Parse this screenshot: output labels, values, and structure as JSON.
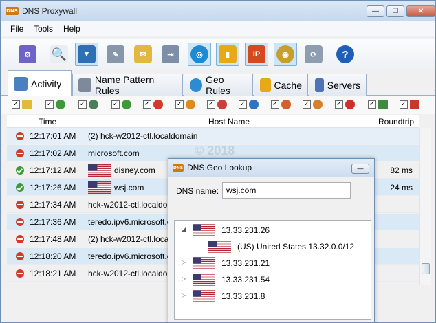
{
  "app": {
    "title": "DNS Proxywall",
    "icon_text": "DNS"
  },
  "menu": [
    "File",
    "Tools",
    "Help"
  ],
  "window_buttons": {
    "minimize": "—",
    "maximize": "☐",
    "close": "✕"
  },
  "toolbar": [
    "settings-icon",
    "search-icon",
    "filter-icon",
    "edit-icon",
    "mail-transfer-icon",
    "network-export-icon",
    "globe-icon",
    "stats-icon",
    "ip-block-icon",
    "coins-globe-icon",
    "sync-icon",
    "help-icon"
  ],
  "tabs": [
    {
      "label": "Activity",
      "active": true
    },
    {
      "label": "Name Pattern Rules",
      "active": false
    },
    {
      "label": "Geo Rules",
      "active": false
    },
    {
      "label": "Cache",
      "active": false
    },
    {
      "label": "Servers",
      "active": false
    }
  ],
  "grid": {
    "headers": {
      "time": "Time",
      "host": "Host Name",
      "roundtrip": "Roundtrip"
    },
    "rows": [
      {
        "status": "blocked",
        "time": "12:17:01 AM",
        "host": "(2) hck-w2012-ctl.localdomain",
        "flag": false,
        "roundtrip": ""
      },
      {
        "status": "blocked",
        "time": "12:17:02 AM",
        "host": "microsoft.com",
        "flag": false,
        "roundtrip": ""
      },
      {
        "status": "ok",
        "time": "12:17:12 AM",
        "host": "disney.com",
        "flag": true,
        "roundtrip": "82 ms"
      },
      {
        "status": "ok",
        "time": "12:17:26 AM",
        "host": "wsj.com",
        "flag": true,
        "roundtrip": "24 ms"
      },
      {
        "status": "blocked",
        "time": "12:17:34 AM",
        "host": "hck-w2012-ctl.localdo",
        "flag": false,
        "roundtrip": ""
      },
      {
        "status": "blocked",
        "time": "12:17:36 AM",
        "host": "teredo.ipv6.microsoft.c",
        "flag": false,
        "roundtrip": ""
      },
      {
        "status": "blocked",
        "time": "12:17:48 AM",
        "host": "(2) hck-w2012-ctl.localdo",
        "flag": false,
        "roundtrip": ""
      },
      {
        "status": "blocked",
        "time": "12:18:20 AM",
        "host": "teredo.ipv6.microsoft.c",
        "flag": false,
        "roundtrip": ""
      },
      {
        "status": "blocked",
        "time": "12:18:21 AM",
        "host": "hck-w2012-ctl.localdo",
        "flag": false,
        "roundtrip": ""
      }
    ]
  },
  "watermark": "© 2018",
  "dialog": {
    "title": "DNS Geo Lookup",
    "icon_text": "DNS",
    "min_button": "—",
    "dns_label": "DNS name:",
    "dns_value": "wsj.com",
    "tree": [
      {
        "label": "13.33.231.26",
        "expanded": true,
        "level": 0
      },
      {
        "label": "(US) United States   13.32.0.0/12",
        "expanded": null,
        "level": 1
      },
      {
        "label": "13.33.231.21",
        "expanded": false,
        "level": 0
      },
      {
        "label": "13.33.231.54",
        "expanded": false,
        "level": 0
      },
      {
        "label": "13.33.231.8",
        "expanded": false,
        "level": 0
      }
    ]
  },
  "colors": {
    "accent": "#3a7bd5",
    "blocked": "#d23a2a",
    "ok": "#3e9a38",
    "row_alt": "#d9e9f6"
  }
}
